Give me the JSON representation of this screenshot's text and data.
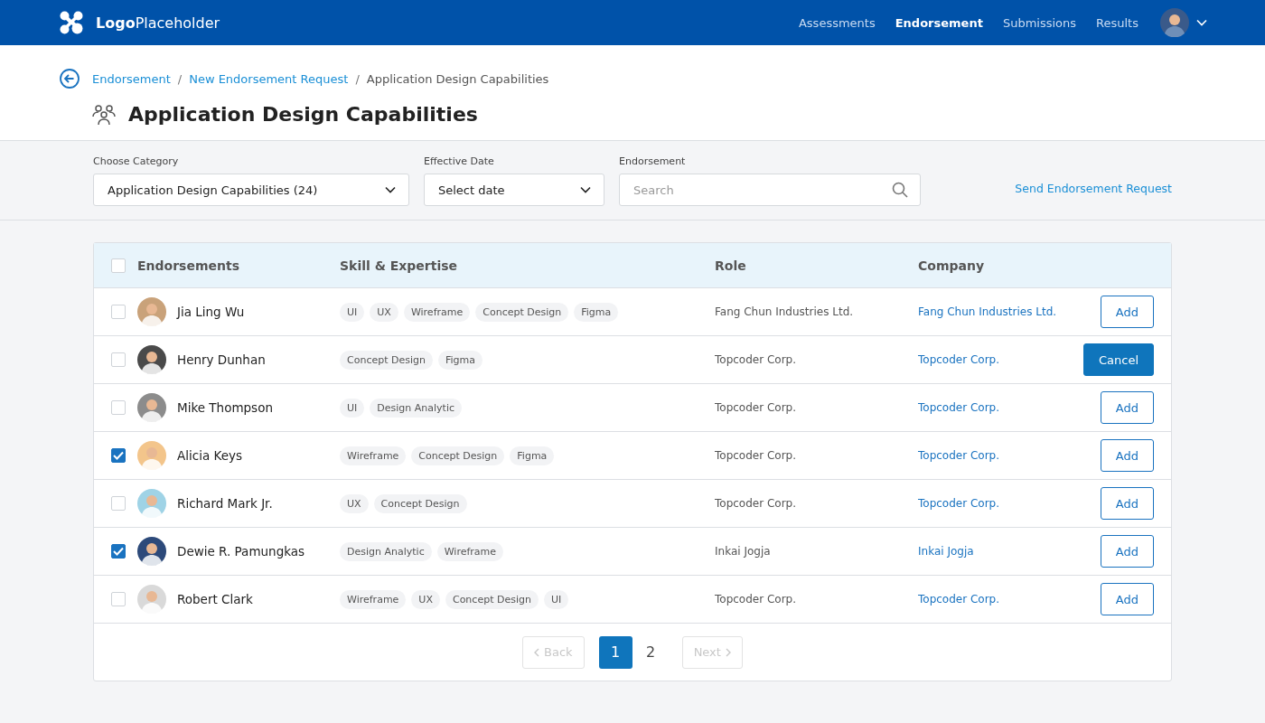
{
  "header": {
    "logo": "**Logo**Placeholder",
    "nav": [
      {
        "label": "Assessments",
        "selected": false
      },
      {
        "label": "Endorsement",
        "selected": true
      },
      {
        "label": "Submissions",
        "selected": false
      },
      {
        "label": "Results",
        "selected": false
      }
    ]
  },
  "breadcrumb": [
    {
      "label": "Endorsement",
      "kind": "link"
    },
    {
      "label": "/",
      "kind": "separator"
    },
    {
      "label": "New Endorsement Request",
      "kind": "link"
    },
    {
      "label": "/",
      "kind": "separator"
    },
    {
      "label": "Application Design Capabilities",
      "kind": "current"
    }
  ],
  "title": "Application Design Capabilities",
  "filters": {
    "category": {
      "label": "Choose Category",
      "value": "Application Design Capabilities (24)"
    },
    "date": {
      "label": "Effective Date",
      "value": "Select date"
    },
    "search": {
      "label": "Endorsement",
      "placeholder": "Search"
    },
    "link": "Send Endorsement Request"
  },
  "table": {
    "select_all_checked": false,
    "columns": [
      "Endorsements",
      "Skill & Expertise",
      "Role",
      "Company"
    ],
    "rows": [
      {
        "checked": false,
        "name": "Jia Ling Wu",
        "skills": [
          "UI",
          "UX",
          "Wireframe",
          "Concept Design",
          "Figma"
        ],
        "role": "Fang Chun Industries Ltd.",
        "company": "Fang Chun Industries Ltd.",
        "action": {
          "label": "Add",
          "kind": "outline"
        }
      },
      {
        "checked": false,
        "name": "Henry Dunhan",
        "skills": [
          "Concept Design",
          "Figma"
        ],
        "role": "Topcoder Corp.",
        "company": "Topcoder Corp.",
        "action": {
          "label": "Cancel",
          "kind": "filled"
        }
      },
      {
        "checked": false,
        "name": "Mike Thompson",
        "skills": [
          "UI",
          "Design Analytic"
        ],
        "role": "Topcoder Corp.",
        "company": "Topcoder Corp.",
        "action": {
          "label": "Add",
          "kind": "outline"
        }
      },
      {
        "checked": true,
        "name": "Alicia Keys",
        "skills": [
          "Wireframe",
          "Concept Design",
          "Figma"
        ],
        "role": "Topcoder Corp.",
        "company": "Topcoder Corp.",
        "action": {
          "label": "Add",
          "kind": "outline"
        }
      },
      {
        "checked": false,
        "name": "Richard Mark Jr.",
        "skills": [
          "UX",
          "Concept Design"
        ],
        "role": "Topcoder Corp.",
        "company": "Topcoder Corp.",
        "action": {
          "label": "Add",
          "kind": "outline"
        }
      },
      {
        "checked": true,
        "name": "Dewie R. Pamungkas",
        "skills": [
          "Design Analytic",
          "Wireframe"
        ],
        "role": "Inkai Jogja",
        "company": "Inkai Jogja",
        "action": {
          "label": "Add",
          "kind": "outline"
        }
      },
      {
        "checked": false,
        "name": "Robert Clark",
        "skills": [
          "Wireframe",
          "UX",
          "Concept Design",
          "UI"
        ],
        "role": "Topcoder Corp.",
        "company": "Topcoder Corp.",
        "action": {
          "label": "Add",
          "kind": "outline"
        }
      }
    ]
  },
  "pagination": {
    "back": {
      "label": "Back",
      "disabled": true
    },
    "pages": [
      {
        "label": "1",
        "selected": true
      },
      {
        "label": "2",
        "selected": false
      }
    ],
    "next": {
      "label": "Next",
      "disabled": true
    }
  }
}
